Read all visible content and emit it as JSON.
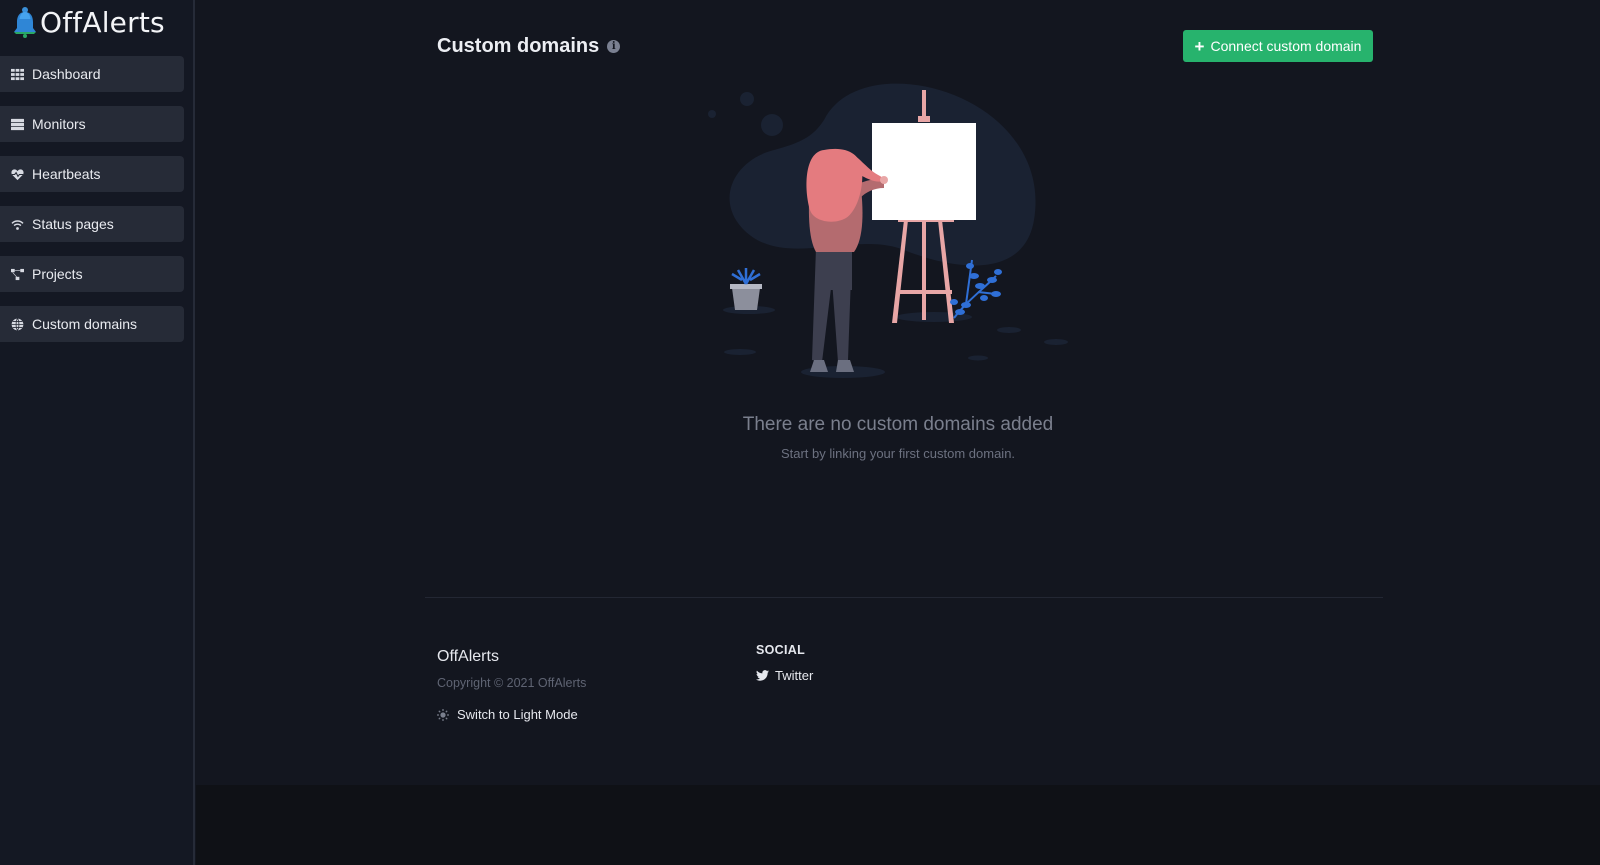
{
  "app": {
    "name": "OffAlerts"
  },
  "sidebar": {
    "items": [
      {
        "label": "Dashboard",
        "icon": "grid-icon"
      },
      {
        "label": "Monitors",
        "icon": "server-icon"
      },
      {
        "label": "Heartbeats",
        "icon": "heartbeat-icon"
      },
      {
        "label": "Status pages",
        "icon": "wifi-icon"
      },
      {
        "label": "Projects",
        "icon": "project-diagram-icon"
      },
      {
        "label": "Custom domains",
        "icon": "globe-icon"
      }
    ]
  },
  "header": {
    "title": "Custom domains",
    "info_icon": "i",
    "connect_button": "Connect custom domain",
    "connect_button_icon": "+"
  },
  "empty_state": {
    "title": "There are no custom domains added",
    "subtitle": "Start by linking your first custom domain."
  },
  "footer": {
    "brand": "OffAlerts",
    "copyright": "Copyright © 2021 OffAlerts",
    "theme_toggle": "Switch to Light Mode",
    "social_heading": "SOCIAL",
    "social_links": [
      {
        "label": "Twitter",
        "icon": "twitter-icon"
      }
    ]
  },
  "colors": {
    "background": "#13161f",
    "sidebar_item": "#262b37",
    "accent_green": "#27b36d",
    "muted_text": "#7a7f8d"
  }
}
